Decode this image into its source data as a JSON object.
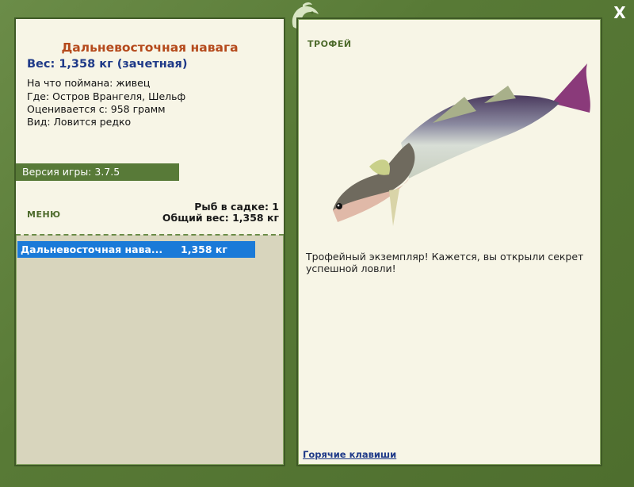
{
  "fish": {
    "title": "Дальневосточная навага",
    "weight": "Вес: 1,358 кг (зачетная)",
    "caught_on": "На что поймана: живец",
    "location": "Где: Остров Врангеля, Шельф",
    "valued_from": "Оценивается с: 958 грамм",
    "kind": "Вид: Ловится редко"
  },
  "version": "Версия игры: 3.7.5",
  "menu_label": "МЕНЮ",
  "cage": {
    "count": "Рыб в садке: 1",
    "total": "Общий вес: 1,358 кг"
  },
  "catch_list": [
    {
      "name": "Дальневосточная нава...",
      "weight": "1,358 кг"
    }
  ],
  "trophy": {
    "label": "ТРОФЕЙ",
    "description": "Трофейный экземпляр! Кажется, вы открыли секрет успешной ловли!"
  },
  "hotkeys_label": "Горячие клавиши",
  "close_label": "X",
  "icons": {
    "close": "close-icon",
    "logo": "fish-logo-icon",
    "fish": "fish-image"
  },
  "colors": {
    "frame": "#5a7a3c",
    "panel": "#f7f5e6",
    "title": "#b54a1c",
    "weight": "#1f3a88",
    "selection": "#1a7ad8"
  }
}
